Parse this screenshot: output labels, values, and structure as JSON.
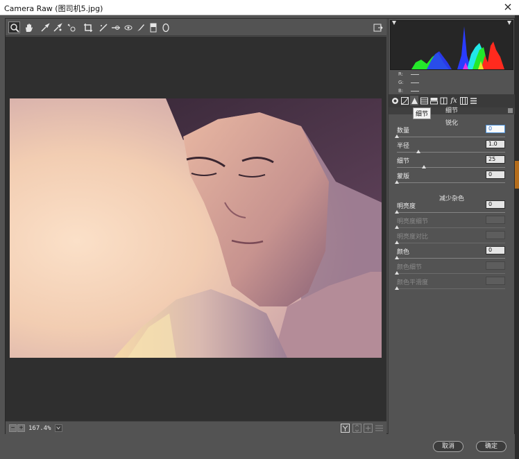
{
  "window": {
    "title": "Camera Raw (图司机5.jpg)"
  },
  "toolbar": {
    "tools": [
      {
        "name": "zoom-icon"
      },
      {
        "name": "hand-icon"
      },
      {
        "name": "white-balance-icon"
      },
      {
        "name": "color-sampler-icon"
      },
      {
        "name": "targeted-adjustment-icon"
      },
      {
        "name": "crop-icon"
      },
      {
        "name": "straighten-icon"
      },
      {
        "name": "spot-removal-icon"
      },
      {
        "name": "red-eye-icon"
      },
      {
        "name": "adjustment-brush-icon"
      },
      {
        "name": "graduated-filter-icon"
      },
      {
        "name": "radial-filter-icon"
      }
    ],
    "right_icon": "open-preferences-icon"
  },
  "status": {
    "zoom": "167.4%",
    "zoom_minus": "−",
    "zoom_plus": "+"
  },
  "histogram": {
    "rgb_labels": [
      "R:",
      "G:",
      "B:"
    ],
    "colors": {
      "red": "#ff2a1e",
      "green": "#24e82a",
      "blue": "#2a3cff",
      "cyan": "#22e8e8",
      "magenta": "#e830e8",
      "yellow": "#e8e82a"
    }
  },
  "panel": {
    "tabs": [
      {
        "name": "basic-tab-icon"
      },
      {
        "name": "tone-curve-tab-icon"
      },
      {
        "name": "detail-tab-icon"
      },
      {
        "name": "hsl-tab-icon"
      },
      {
        "name": "split-toning-tab-icon"
      },
      {
        "name": "lens-corrections-tab-icon"
      },
      {
        "name": "effects-tab-icon"
      },
      {
        "name": "camera-calibration-tab-icon"
      },
      {
        "name": "presets-tab-icon"
      }
    ],
    "tooltip": "细节",
    "header": "细节",
    "sharpen": {
      "title": "锐化",
      "controls": [
        {
          "label": "数量",
          "value": "0",
          "level": 0.0,
          "enabled": true,
          "focused": true
        },
        {
          "label": "半径",
          "value": "1.0",
          "level": 0.2,
          "enabled": true,
          "focused": false
        },
        {
          "label": "细节",
          "value": "25",
          "level": 0.25,
          "enabled": true,
          "focused": false
        },
        {
          "label": "蒙版",
          "value": "0",
          "level": 0.0,
          "enabled": true,
          "focused": false
        }
      ]
    },
    "noise": {
      "title": "减少杂色",
      "controls": [
        {
          "label": "明亮度",
          "value": "0",
          "level": 0.0,
          "enabled": true
        },
        {
          "label": "明亮度细节",
          "value": "",
          "level": 0.0,
          "enabled": false
        },
        {
          "label": "明亮度对比",
          "value": "",
          "level": 0.0,
          "enabled": false
        },
        {
          "label": "颜色",
          "value": "0",
          "level": 0.0,
          "enabled": true
        },
        {
          "label": "颜色细节",
          "value": "",
          "level": 0.0,
          "enabled": false
        },
        {
          "label": "颜色平滑度",
          "value": "",
          "level": 0.0,
          "enabled": false
        }
      ]
    }
  },
  "buttons": {
    "cancel": "取消",
    "ok": "确定"
  }
}
